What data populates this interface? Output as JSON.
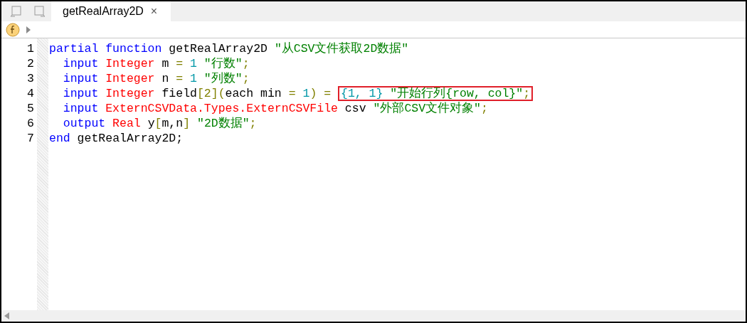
{
  "tab": {
    "title": "getRealArray2D",
    "close": "×",
    "selected": true
  },
  "lines": [
    {
      "number": "1",
      "tokens": [
        {
          "kind": "keyword",
          "text": "partial function"
        },
        {
          "kind": "ident",
          "text": " getRealArray2D "
        },
        {
          "kind": "string",
          "text": "\"从CSV文件获取2D数据\""
        }
      ]
    },
    {
      "number": "2",
      "tokens": [
        {
          "kind": "keyword",
          "text": "  input"
        },
        {
          "kind": "type",
          "text": " Integer"
        },
        {
          "kind": "ident",
          "text": " m "
        },
        {
          "kind": "op",
          "text": "="
        },
        {
          "kind": "number",
          "text": " 1"
        },
        {
          "kind": "string",
          "text": " \"行数\""
        },
        {
          "kind": "op",
          "text": ";"
        }
      ]
    },
    {
      "number": "3",
      "tokens": [
        {
          "kind": "keyword",
          "text": "  input"
        },
        {
          "kind": "type",
          "text": " Integer"
        },
        {
          "kind": "ident",
          "text": " n "
        },
        {
          "kind": "op",
          "text": "="
        },
        {
          "kind": "number",
          "text": " 1"
        },
        {
          "kind": "string",
          "text": " \"列数\""
        },
        {
          "kind": "op",
          "text": ";"
        }
      ]
    },
    {
      "number": "4",
      "tokens": [
        {
          "kind": "keyword",
          "text": "  input"
        },
        {
          "kind": "type",
          "text": " Integer"
        },
        {
          "kind": "ident",
          "text": " field"
        },
        {
          "kind": "op",
          "text": "[2]("
        },
        {
          "kind": "ident",
          "text": "each min "
        },
        {
          "kind": "op",
          "text": "="
        },
        {
          "kind": "number",
          "text": " 1"
        },
        {
          "kind": "op",
          "text": ") = "
        },
        {
          "kind": "annotation-box",
          "tokens": [
            {
              "kind": "number",
              "text": "{1, 1}"
            },
            {
              "kind": "string",
              "text": " \"开始行列{row, col}\""
            },
            {
              "kind": "op",
              "text": ";"
            }
          ]
        }
      ]
    },
    {
      "number": "5",
      "tokens": [
        {
          "kind": "keyword",
          "text": "  input"
        },
        {
          "kind": "type",
          "text": " ExternCSVData.Types.ExternCSVFile"
        },
        {
          "kind": "ident",
          "text": " csv "
        },
        {
          "kind": "string",
          "text": "\"外部CSV文件对象\""
        },
        {
          "kind": "op",
          "text": ";"
        }
      ]
    },
    {
      "number": "6",
      "tokens": [
        {
          "kind": "keyword",
          "text": "  output"
        },
        {
          "kind": "type",
          "text": " Real"
        },
        {
          "kind": "ident",
          "text": " y"
        },
        {
          "kind": "op",
          "text": "["
        },
        {
          "kind": "ident",
          "text": "m,n"
        },
        {
          "kind": "op",
          "text": "]"
        },
        {
          "kind": "string",
          "text": " \"2D数据\""
        },
        {
          "kind": "op",
          "text": ";"
        }
      ]
    },
    {
      "number": "7",
      "tokens": [
        {
          "kind": "keyword",
          "text": "end"
        },
        {
          "kind": "ident",
          "text": " getRealArray2D;"
        }
      ]
    }
  ]
}
